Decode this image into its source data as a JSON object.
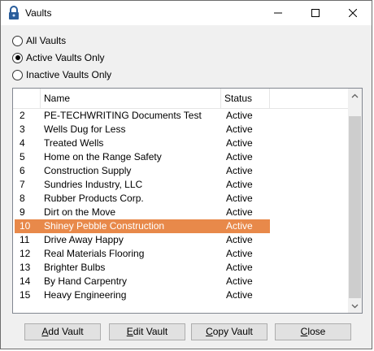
{
  "window": {
    "title": "Vaults"
  },
  "filters": [
    {
      "label": "All Vaults",
      "checked": false
    },
    {
      "label": "Active Vaults Only",
      "checked": true
    },
    {
      "label": "Inactive Vaults Only",
      "checked": false
    }
  ],
  "list": {
    "columns": [
      "",
      "Name",
      "Status"
    ],
    "rows": [
      {
        "id": "2",
        "name": "PE-TECHWRITING Documents Test",
        "status": "Active"
      },
      {
        "id": "3",
        "name": "Wells Dug for Less",
        "status": "Active"
      },
      {
        "id": "4",
        "name": "Treated Wells",
        "status": "Active"
      },
      {
        "id": "5",
        "name": "Home on the Range Safety",
        "status": "Active"
      },
      {
        "id": "6",
        "name": "Construction Supply",
        "status": "Active"
      },
      {
        "id": "7",
        "name": "Sundries Industry, LLC",
        "status": "Active"
      },
      {
        "id": "8",
        "name": "Rubber Products Corp.",
        "status": "Active"
      },
      {
        "id": "9",
        "name": "Dirt on the Move",
        "status": "Active"
      },
      {
        "id": "10",
        "name": "Shiney Pebble Construction",
        "status": "Active",
        "selected": true
      },
      {
        "id": "11",
        "name": "Drive Away Happy",
        "status": "Active"
      },
      {
        "id": "12",
        "name": "Real Materials Flooring",
        "status": "Active"
      },
      {
        "id": "13",
        "name": "Brighter Bulbs",
        "status": "Active"
      },
      {
        "id": "14",
        "name": "By Hand Carpentry",
        "status": "Active"
      },
      {
        "id": "15",
        "name": "Heavy Engineering",
        "status": "Active"
      }
    ]
  },
  "buttons": {
    "add": {
      "mnemonic": "A",
      "rest": "dd Vault"
    },
    "edit": {
      "mnemonic": "E",
      "rest": "dit Vault"
    },
    "copy": {
      "mnemonic": "C",
      "rest": "opy Vault"
    },
    "close": {
      "mnemonic": "C",
      "rest": "lose"
    }
  },
  "colors": {
    "selection": "#e8894a",
    "window_bg": "#f0f0f0"
  },
  "icons": [
    "lock-icon",
    "minimize-icon",
    "maximize-icon",
    "close-icon",
    "chevron-up-icon",
    "chevron-down-icon"
  ]
}
